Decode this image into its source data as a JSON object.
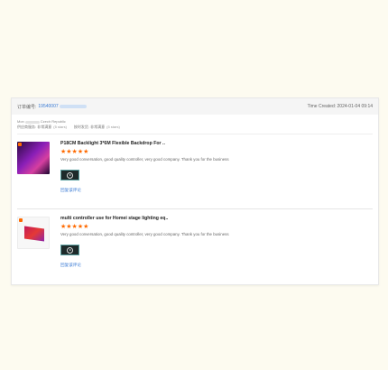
{
  "order": {
    "number_label": "订单编号:",
    "number_value": "19540007",
    "time_created": "Time Created: 2024-01-04 09:14"
  },
  "buyer": {
    "country_prefix": "Mon",
    "country_suffix": "Czech Republic"
  },
  "ratings": {
    "service_label": "供应商服务: 非常满意",
    "service_stars": "(5 stars)",
    "ontime_label": "按时发货: 非常满意",
    "ontime_stars": "(5 stars)"
  },
  "reviews": [
    {
      "title": "P18CM Backlight 3*6M Flexible Backdrop For ..",
      "stars": "★★★★★",
      "comment": "Very good conversation, good quality controller, very good company. Thank you for the business",
      "link": "回复该评论"
    },
    {
      "title": "multi controller use for Homei stage lighting eq..",
      "stars": "★★★★★",
      "comment": "Very good conversation, good quality controller, very good company. Thank you for the business",
      "link": "回复该评论"
    }
  ],
  "colors": {
    "accent": "#ff6a00",
    "link": "#3a7bd5",
    "page_bg": "#fdfbf0"
  }
}
